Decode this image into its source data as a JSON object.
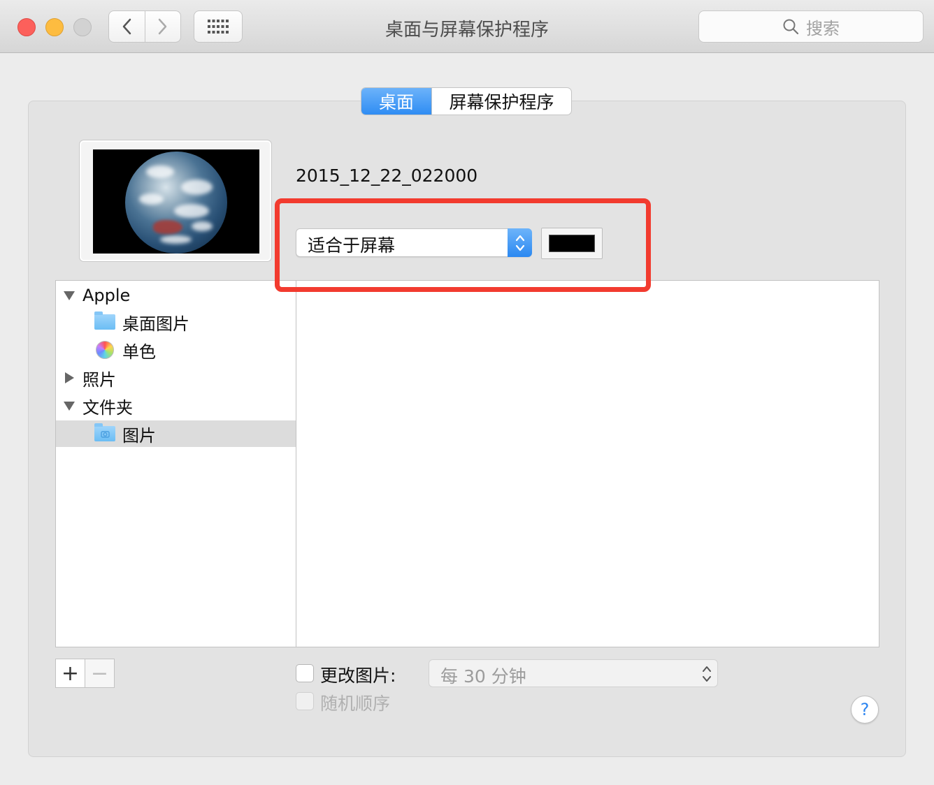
{
  "window": {
    "title": "桌面与屏幕保护程序",
    "search_placeholder": "搜索"
  },
  "tabs": [
    {
      "label": "桌面",
      "active": true
    },
    {
      "label": "屏幕保护程序",
      "active": false
    }
  ],
  "desktop": {
    "image_name": "2015_12_22_022000",
    "fit_option": "适合于屏幕",
    "fill_color": "#000000"
  },
  "sources": {
    "apple": "Apple",
    "desktop_pictures": "桌面图片",
    "solid_colors": "单色",
    "photos": "照片",
    "folders": "文件夹",
    "pictures": "图片"
  },
  "controls": {
    "add": "+",
    "remove": "−",
    "change_picture_label": "更改图片:",
    "interval": "每 30 分钟",
    "random_order_label": "随机顺序",
    "help": "?"
  },
  "colors": {
    "accent": "#2f8df3",
    "highlight": "#f23b2f"
  }
}
